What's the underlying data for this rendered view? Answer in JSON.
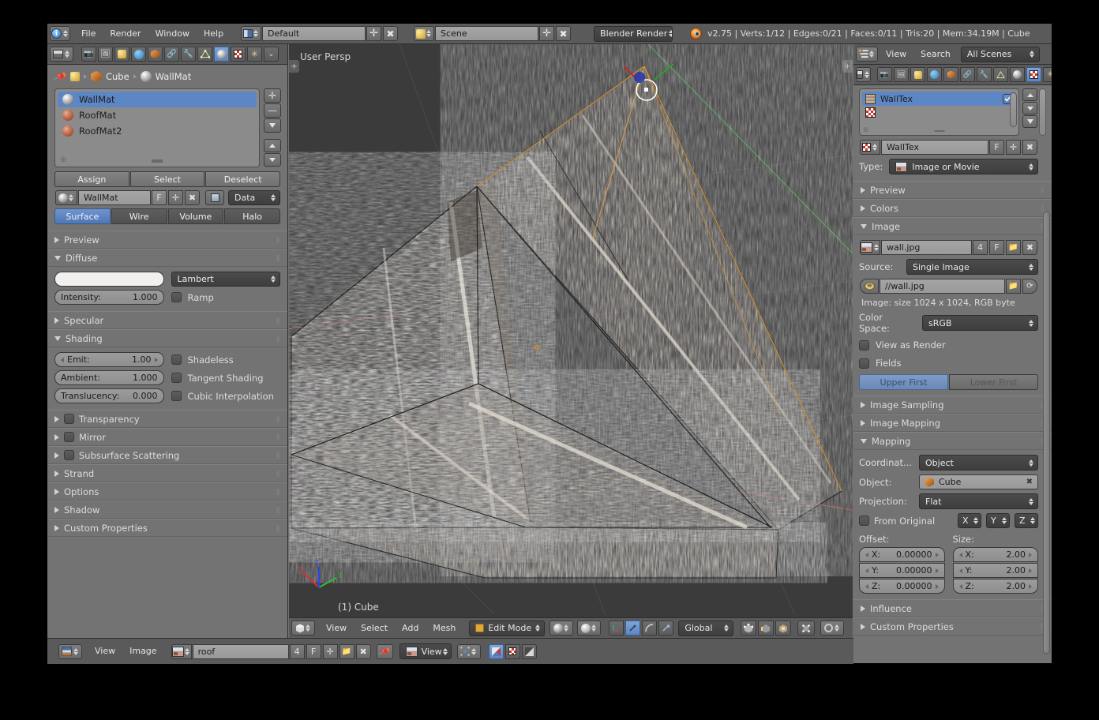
{
  "app": {
    "version_status": "v2.75 | Verts:1/12 | Edges:0/21 | Faces:0/11 | Tris:20 | Mem:34.19M | Cube",
    "engine": "Blender Render",
    "screen_layout": "Default",
    "scene": "Scene"
  },
  "topbar": {
    "menus": [
      "File",
      "Render",
      "Window",
      "Help"
    ]
  },
  "properties_left": {
    "breadcrumb": [
      "Cube",
      "WallMat"
    ],
    "material_slots": [
      {
        "name": "WallMat",
        "selected": true,
        "color": "light"
      },
      {
        "name": "RoofMat",
        "selected": false,
        "color": "red"
      },
      {
        "name": "RoofMat2",
        "selected": false,
        "color": "red"
      }
    ],
    "slot_buttons": [
      "Assign",
      "Select",
      "Deselect"
    ],
    "datablock": {
      "name": "WallMat",
      "fake_user": "F",
      "link": "Data"
    },
    "type_tabs": [
      {
        "label": "Surface",
        "active": true
      },
      {
        "label": "Wire",
        "active": false
      },
      {
        "label": "Volume",
        "active": false
      },
      {
        "label": "Halo",
        "active": false
      }
    ],
    "panels": [
      {
        "label": "Preview",
        "open": false
      },
      {
        "label": "Diffuse",
        "open": true
      },
      {
        "label": "Specular",
        "open": false
      },
      {
        "label": "Shading",
        "open": true
      },
      {
        "label": "Transparency",
        "open": false,
        "checkbox": true
      },
      {
        "label": "Mirror",
        "open": false,
        "checkbox": true
      },
      {
        "label": "Subsurface Scattering",
        "open": false,
        "checkbox": true
      },
      {
        "label": "Strand",
        "open": false
      },
      {
        "label": "Options",
        "open": false
      },
      {
        "label": "Shadow",
        "open": false
      },
      {
        "label": "Custom Properties",
        "open": false
      }
    ],
    "diffuse": {
      "color_swatch": "#f2f0ee",
      "shader": "Lambert",
      "intensity_label": "Intensity:",
      "intensity_value": "1.000",
      "ramp_label": "Ramp",
      "ramp_checked": false
    },
    "shading": {
      "emit_label": "Emit:",
      "emit_value": "1.00",
      "ambient_label": "Ambient:",
      "ambient_value": "1.000",
      "translucency_label": "Translucency:",
      "translucency_value": "0.000",
      "shadeless_label": "Shadeless",
      "tangent_label": "Tangent Shading",
      "cubic_label": "Cubic Interpolation"
    }
  },
  "viewport": {
    "view_name": "User Persp",
    "object_info": "(1) Cube",
    "axis_x": "x",
    "axis_y": "y",
    "axis_z": "z",
    "header": {
      "menus": [
        "View",
        "Select",
        "Add",
        "Mesh"
      ],
      "mode": "Edit Mode",
      "transform_orientation": "Global"
    }
  },
  "image_editor": {
    "menus": [
      "View",
      "Image"
    ],
    "image_name": "roof",
    "users": "4",
    "fake_user": "F",
    "mode": "View"
  },
  "properties_right": {
    "outliner_header": {
      "menus": [
        "View",
        "Search"
      ],
      "display_mode": "All Scenes"
    },
    "texture_slots": [
      {
        "name": "WallTex",
        "selected": true,
        "enabled": true
      }
    ],
    "datablock": {
      "name": "WallTex",
      "fake_user": "F"
    },
    "type_label": "Type:",
    "type_value": "Image or Movie",
    "panels": [
      {
        "label": "Preview",
        "open": false
      },
      {
        "label": "Colors",
        "open": false
      },
      {
        "label": "Image",
        "open": true
      },
      {
        "label": "Image Sampling",
        "open": false
      },
      {
        "label": "Image Mapping",
        "open": false
      },
      {
        "label": "Mapping",
        "open": true
      },
      {
        "label": "Influence",
        "open": false
      },
      {
        "label": "Custom Properties",
        "open": false
      }
    ],
    "image": {
      "name": "wall.jpg",
      "users": "4",
      "fake_user": "F",
      "source_label": "Source:",
      "source_value": "Single Image",
      "path": "//wall.jpg",
      "info": "Image: size 1024 x 1024, RGB byte",
      "colorspace_label": "Color Space:",
      "colorspace_value": "sRGB",
      "view_as_render_label": "View as Render",
      "view_as_render_checked": false,
      "fields_label": "Fields",
      "fields_checked": false,
      "field_order": [
        {
          "label": "Upper First",
          "active": true
        },
        {
          "label": "Lower First",
          "active": false
        }
      ]
    },
    "mapping": {
      "coordinates_label": "Coordinat...",
      "coordinates_value": "Object",
      "object_label": "Object:",
      "object_value": "Cube",
      "projection_label": "Projection:",
      "projection_value": "Flat",
      "from_original_label": "From Original",
      "from_original_checked": false,
      "axis_buttons": [
        "X",
        "Y",
        "Z"
      ],
      "offset_label": "Offset:",
      "size_label": "Size:",
      "offset": [
        {
          "axis": "X:",
          "value": "0.00000"
        },
        {
          "axis": "Y:",
          "value": "0.00000"
        },
        {
          "axis": "Z:",
          "value": "0.00000"
        }
      ],
      "size": [
        {
          "axis": "X:",
          "value": "2.00"
        },
        {
          "axis": "Y:",
          "value": "2.00"
        },
        {
          "axis": "Z:",
          "value": "2.00"
        }
      ]
    }
  },
  "colors": {
    "bg": "#737373",
    "header": "#5a5a5a",
    "viewport_bg": "#3b3b3b",
    "accent_blue": "#5680c2",
    "selected_edge": "#e8a33d"
  }
}
